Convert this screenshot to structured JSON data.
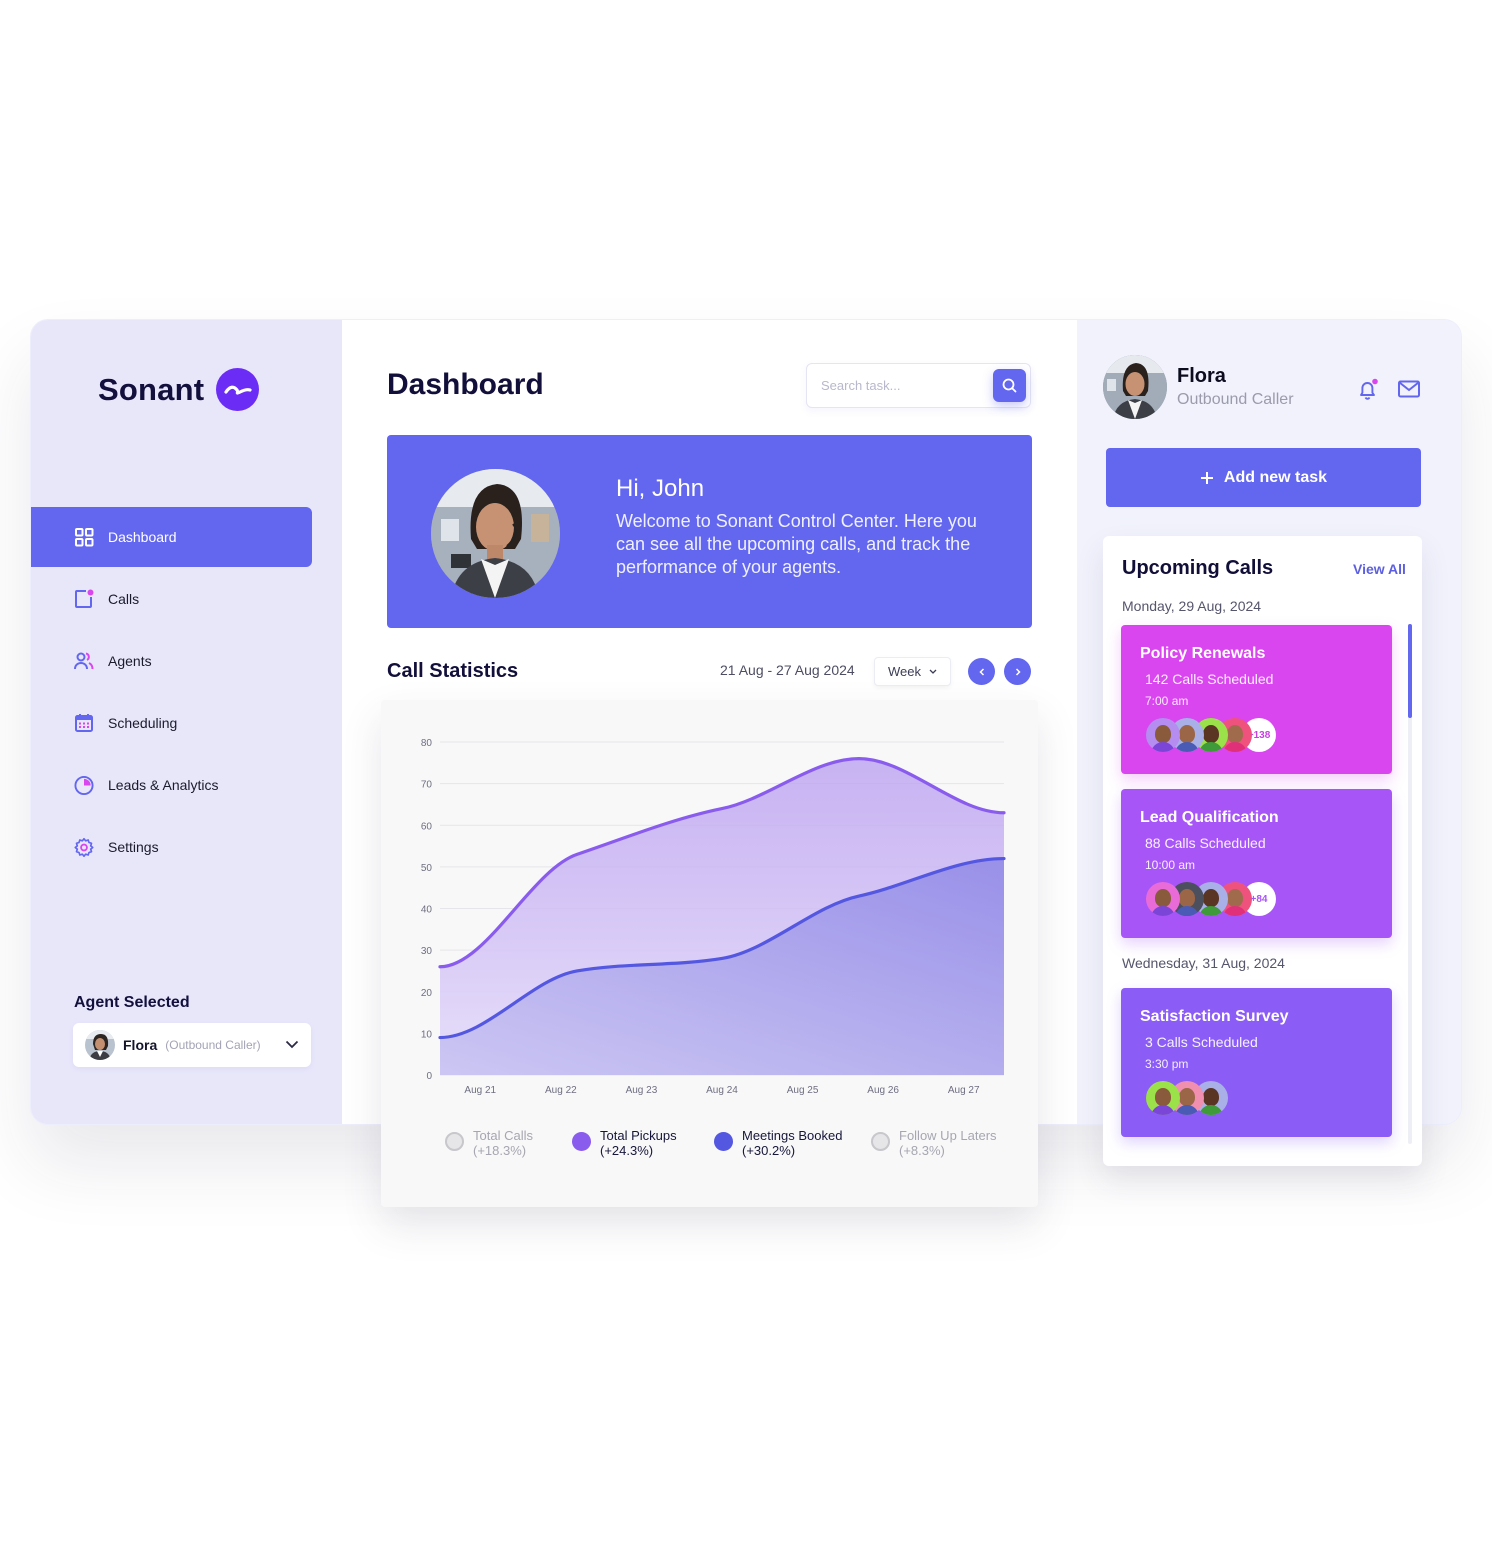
{
  "brand": {
    "name": "Sonant",
    "accent": "#6366ee",
    "logo_color": "#6b2cf5"
  },
  "sidebar": {
    "items": [
      {
        "label": "Dashboard",
        "icon": "grid-icon",
        "active": true
      },
      {
        "label": "Calls",
        "icon": "calls-icon",
        "active": false
      },
      {
        "label": "Agents",
        "icon": "agents-icon",
        "active": false
      },
      {
        "label": "Scheduling",
        "icon": "calendar-icon",
        "active": false
      },
      {
        "label": "Leads & Analytics",
        "icon": "pie-chart-icon",
        "active": false
      },
      {
        "label": "Settings",
        "icon": "gear-icon",
        "active": false
      }
    ],
    "agent_selected": {
      "label": "Agent Selected",
      "name": "Flora",
      "role": "(Outbound Caller)"
    }
  },
  "header": {
    "title": "Dashboard",
    "search_placeholder": "Search task..."
  },
  "banner": {
    "greeting": "Hi, John",
    "message": "Welcome to Sonant Control Center. Here you can see all the upcoming calls, and track the performance of your agents."
  },
  "call_statistics": {
    "title": "Call Statistics",
    "date_range": "21 Aug - 27 Aug 2024",
    "period": "Week"
  },
  "chart_data": {
    "type": "area",
    "title": "Call Statistics",
    "x": [
      "Aug 21",
      "Aug 22",
      "Aug 23",
      "Aug 24",
      "Aug 25",
      "Aug 26",
      "Aug 27"
    ],
    "xlabel": "",
    "ylabel": "",
    "ylim": [
      0,
      80
    ],
    "yticks": [
      0,
      10,
      20,
      30,
      40,
      50,
      60,
      70,
      80
    ],
    "grid": true,
    "series": [
      {
        "name": "Total Pickups",
        "change": "(+24.3%)",
        "color": "#8a5ced",
        "visible": true,
        "points_x": [
          20.5,
          22.2,
          24.0,
          25.7,
          27.5
        ],
        "values": [
          26,
          53,
          64,
          76,
          63
        ]
      },
      {
        "name": "Meetings Booked",
        "change": "(+30.2%)",
        "color": "#5457e0",
        "visible": true,
        "points_x": [
          20.5,
          22.2,
          24.0,
          25.7,
          27.5
        ],
        "values": [
          9,
          25,
          28,
          43,
          52
        ]
      }
    ],
    "legend": [
      {
        "name": "Total Calls",
        "change": "(+18.3%)",
        "visible": false,
        "color": "#e6e6e8"
      },
      {
        "name": "Total Pickups",
        "change": "(+24.3%)",
        "visible": true,
        "color": "#8a5ced"
      },
      {
        "name": "Meetings Booked",
        "change": "(+30.2%)",
        "visible": true,
        "color": "#5457e0"
      },
      {
        "name": "Follow Up Laters",
        "change": "(+8.3%)",
        "visible": false,
        "color": "#e6e6e8"
      }
    ],
    "legend_position": "bottom"
  },
  "user": {
    "name": "Flora",
    "role": "Outbound Caller",
    "notification_dot": true
  },
  "add_task_label": "Add new task",
  "upcoming": {
    "title": "Upcoming Calls",
    "view_all": "View All",
    "groups": [
      {
        "date": "Monday, 29 Aug, 2024",
        "calls": [
          {
            "title": "Policy Renewals",
            "count": "142 Calls Scheduled",
            "time": "7:00 am",
            "color": "#d946ef",
            "more": "+138",
            "more_color": "#c640e0",
            "avatars": [
              "#b58cf0",
              "#a9b0e8",
              "#9be24a",
              "#f0527e"
            ]
          },
          {
            "title": "Lead Qualification",
            "count": "88 Calls Scheduled",
            "time": "10:00 am",
            "color": "#a855f7",
            "more": "+84",
            "more_color": "#a855f7",
            "avatars": [
              "#e96bd8",
              "#4b4f5e",
              "#a9b0e8",
              "#f0527e"
            ]
          }
        ]
      },
      {
        "date": "Wednesday, 31 Aug, 2024",
        "calls": [
          {
            "title": "Satisfaction Survey",
            "count": "3 Calls Scheduled",
            "time": "3:30 pm",
            "color": "#8b5cf6",
            "more": "",
            "more_color": "",
            "avatars": [
              "#9be24a",
              "#f08fb0",
              "#a9b0e8"
            ]
          }
        ]
      }
    ]
  }
}
